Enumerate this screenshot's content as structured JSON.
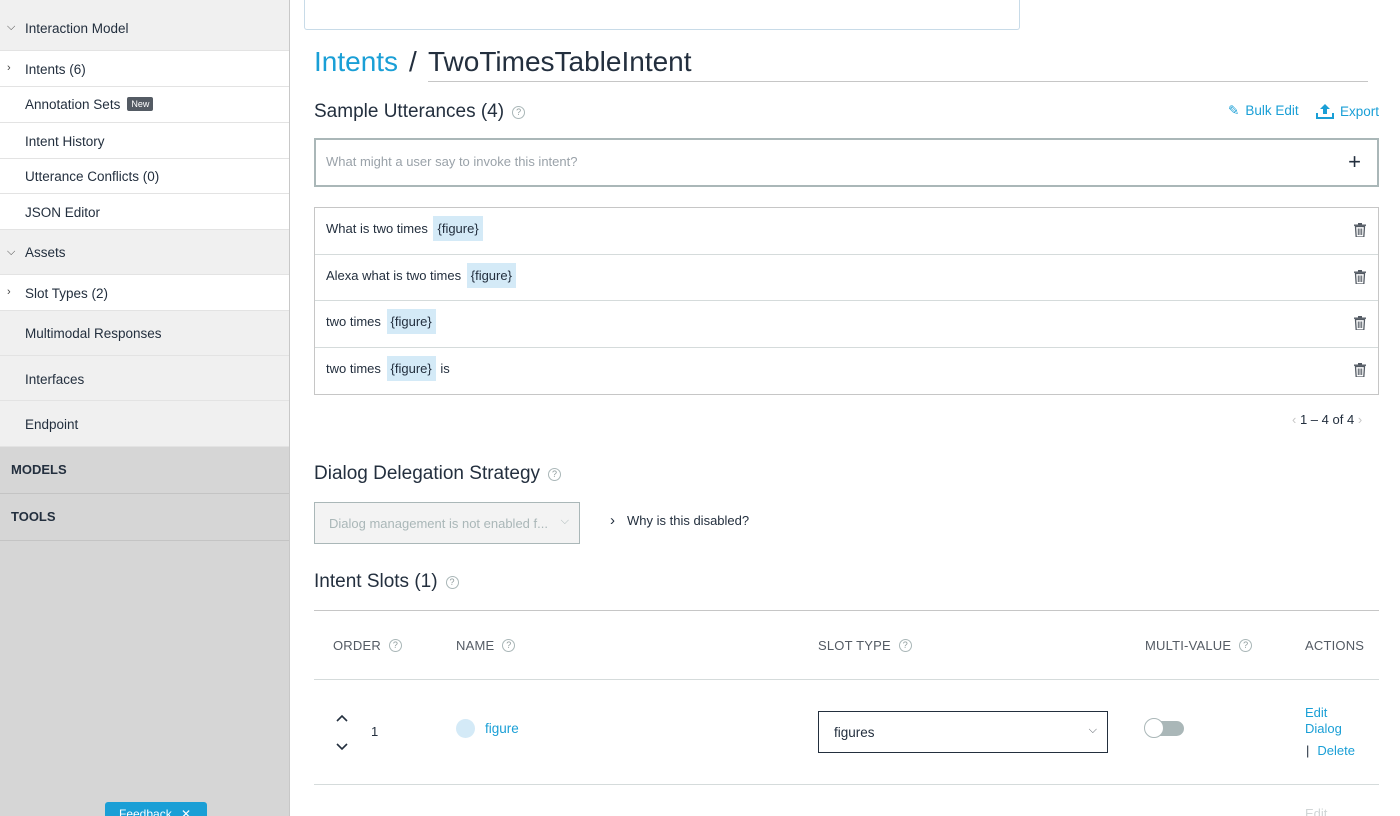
{
  "sidebar": {
    "interaction_model": "Interaction Model",
    "intents": "Intents (6)",
    "annotation_sets": "Annotation Sets",
    "new_badge": "New",
    "intent_history": "Intent History",
    "utterance_conflicts": "Utterance Conflicts (0)",
    "json_editor": "JSON Editor",
    "assets": "Assets",
    "slot_types": "Slot Types (2)",
    "multimodal_responses": "Multimodal Responses",
    "interfaces": "Interfaces",
    "endpoint": "Endpoint",
    "models": "MODELS",
    "tools": "TOOLS",
    "feedback": "Feedback"
  },
  "breadcrumb": {
    "parent": "Intents",
    "separator": "/",
    "current": "TwoTimesTableIntent"
  },
  "sample_utterances": {
    "title": "Sample Utterances (4)",
    "bulk_edit": "Bulk Edit",
    "export": "Export",
    "input_placeholder": "What might a user say to invoke this intent?",
    "add": "+",
    "rows": [
      {
        "before": "What is two times",
        "slot": "{figure}",
        "after": ""
      },
      {
        "before": "Alexa what is two times",
        "slot": "{figure}",
        "after": ""
      },
      {
        "before": "two times",
        "slot": "{figure}",
        "after": ""
      },
      {
        "before": "two times",
        "slot": "{figure}",
        "after": "is"
      }
    ],
    "pagination": "1 – 4 of 4",
    "prev": "‹",
    "next": "›"
  },
  "dialog_delegation": {
    "title": "Dialog Delegation Strategy",
    "select_value": "Dialog management is not enabled f...",
    "why_link": "Why is this disabled?"
  },
  "intent_slots": {
    "title": "Intent Slots (1)",
    "columns": {
      "order": "ORDER",
      "name": "NAME",
      "slot_type": "SLOT TYPE",
      "multi_value": "MULTI-VALUE",
      "actions": "ACTIONS"
    },
    "rows": [
      {
        "order": "1",
        "name": "figure",
        "slot_type": "figures",
        "multi_value": false,
        "edit_dialog": "Edit\nDialog",
        "delete": "Delete"
      }
    ],
    "faded_edit": "Edit"
  },
  "colors": {
    "accent": "#1a9fd6",
    "slot_chip": "#d4eaf7",
    "sidebar_bg": "#d6d6d6"
  }
}
